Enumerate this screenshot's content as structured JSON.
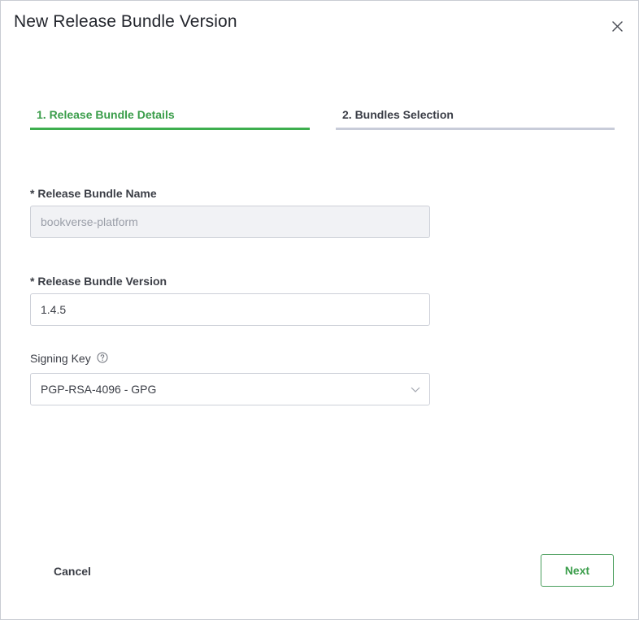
{
  "dialog": {
    "title": "New Release Bundle Version",
    "close_icon": "close-icon"
  },
  "stepper": {
    "steps": [
      {
        "label": "1. Release Bundle Details",
        "state": "active"
      },
      {
        "label": "2. Bundles Selection",
        "state": "inactive"
      }
    ],
    "active_color": "#3dae4e",
    "inactive_color": "#c8ccd9"
  },
  "form": {
    "name": {
      "label": "* Release Bundle Name",
      "value": "bookverse-platform",
      "disabled": true
    },
    "version": {
      "label": "* Release Bundle Version",
      "value": "1.4.5"
    },
    "signing_key": {
      "label": "Signing Key",
      "help_icon": "help-circle-icon",
      "selected": "PGP-RSA-4096 - GPG",
      "chevron_icon": "chevron-down-icon"
    }
  },
  "footer": {
    "cancel_label": "Cancel",
    "next_label": "Next",
    "accent_color": "#3a9d4a"
  }
}
